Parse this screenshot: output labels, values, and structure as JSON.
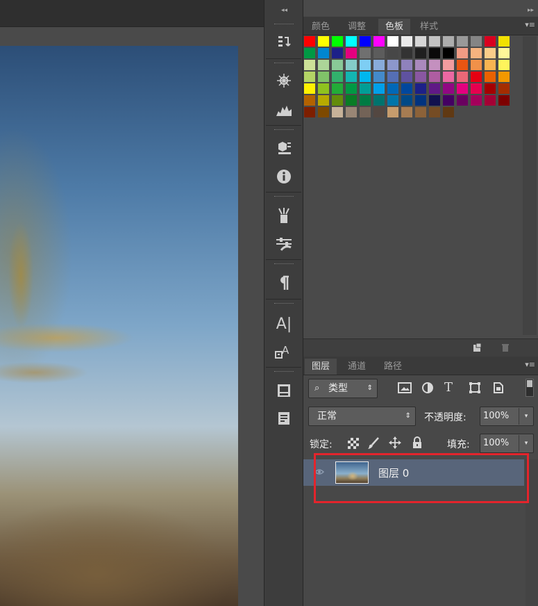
{
  "swatch_panel": {
    "tabs": [
      "颜色",
      "调整",
      "色板",
      "样式"
    ],
    "active_tab": "色板",
    "rows": [
      [
        "#ff0000",
        "#ffff00",
        "#00ff00",
        "#00ffff",
        "#0000ff",
        "#ff00ff",
        "#ffffff",
        "#ebebeb",
        "#d6d6d6",
        "#c2c2c2",
        "#adadad",
        "#999999",
        "#858585",
        "#d9001f",
        "#f2e100"
      ],
      [
        "#009944",
        "#0086d1",
        "#1d2088",
        "#e4007f",
        "#707070",
        "#5c5c5c",
        "#474747",
        "#333333",
        "#1f1f1f",
        "#0a0a0a",
        "#000000",
        "#f19b84",
        "#f6b37f",
        "#facd89",
        "#fff799"
      ],
      [
        "#cce198",
        "#acd598",
        "#89c997",
        "#84ccc9",
        "#7ecef4",
        "#88abda",
        "#8c97cb",
        "#8f82bc",
        "#aa89bd",
        "#c490bf",
        "#f29c9f",
        "#e95513",
        "#f19149",
        "#f8b551",
        "#fff45c"
      ],
      [
        "#b3d465",
        "#80c269",
        "#32b16c",
        "#13b5b1",
        "#00b7ee",
        "#448aca",
        "#556fb5",
        "#5f52a0",
        "#8957a1",
        "#ae5da1",
        "#ea68a2",
        "#eb6877",
        "#e60012",
        "#eb6100",
        "#f39800"
      ],
      [
        "#fff100",
        "#8fc31f",
        "#22ac38",
        "#009944",
        "#009e96",
        "#00a0e9",
        "#0068b7",
        "#00479d",
        "#1d2088",
        "#601986",
        "#920783",
        "#e4007f",
        "#e5004f",
        "#a40000",
        "#a42d00"
      ],
      [
        "#b36200",
        "#b7aa00",
        "#638c0b",
        "#097c25",
        "#007b43",
        "#00736d",
        "#0075a9",
        "#004986",
        "#00337f",
        "#11114e",
        "#440062",
        "#6a005f",
        "#a4005b",
        "#a40035",
        "#7d0000"
      ],
      [
        "#7d1f00",
        "#7d4900",
        "#c7b299",
        "#998675",
        "#736357",
        "#534741",
        "#c69c6d",
        "#a67c52",
        "#8c6239",
        "#754c24",
        "#603913"
      ]
    ]
  },
  "layers_panel": {
    "tabs": [
      "图层",
      "通道",
      "路径"
    ],
    "active_tab": "图层",
    "filter_label": "类型",
    "blend_mode": "正常",
    "opacity_label": "不透明度:",
    "opacity_value": "100%",
    "lock_label": "锁定:",
    "fill_label": "填充:",
    "fill_value": "100%",
    "layers": [
      {
        "name": "图层 0",
        "visible": true
      }
    ]
  },
  "colors": {
    "highlight_border": "#e4242c",
    "selected_layer_bg": "#58657a"
  }
}
